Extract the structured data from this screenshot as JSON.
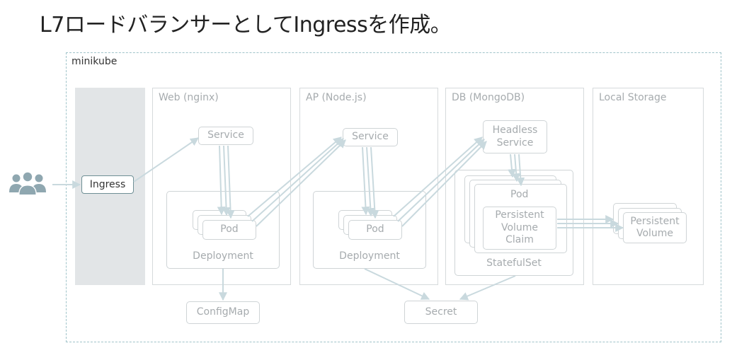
{
  "title": "L7ロードバランサーとしてIngressを作成。",
  "cluster": {
    "label": "minikube"
  },
  "lanes": {
    "web": "Web (nginx)",
    "ap": "AP (Node.js)",
    "db": "DB (MongoDB)",
    "storage": "Local Storage"
  },
  "nodes": {
    "ingress": "Ingress",
    "web_service": "Service",
    "web_pod": "Pod",
    "web_deployment": "Deployment",
    "configmap": "ConfigMap",
    "ap_service": "Service",
    "ap_pod": "Pod",
    "ap_deployment": "Deployment",
    "secret": "Secret",
    "headless_service": "Headless\nService",
    "db_pod": "Pod",
    "pvc": "Persistent\nVolume\nClaim",
    "statefulset": "StatefulSet",
    "pv": "Persistent\nVolume"
  },
  "icons": {
    "users": "users-icon"
  },
  "colors": {
    "arrow": "#c9d9de",
    "border": "#cfd4d6",
    "band": "#e2e5e7",
    "cluster_border": "#9fc3c9"
  }
}
